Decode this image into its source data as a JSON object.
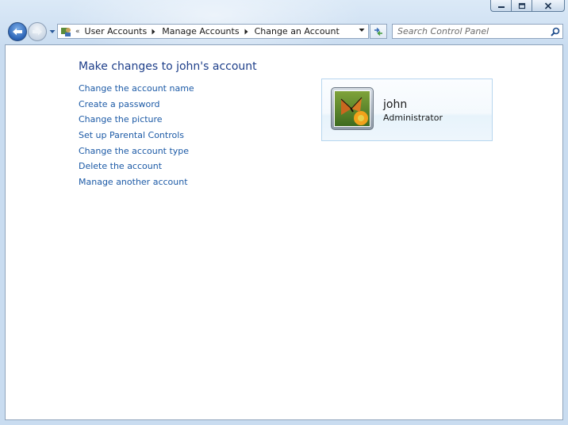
{
  "address_bar": {
    "crumbs": [
      "User Accounts",
      "Manage Accounts",
      "Change an Account"
    ]
  },
  "search": {
    "placeholder": "Search Control Panel"
  },
  "main": {
    "heading": "Make changes to john's account",
    "links": [
      "Change the account name",
      "Create a password",
      "Change the picture",
      "Set up Parental Controls",
      "Change the account type",
      "Delete the account"
    ],
    "manage_link": "Manage another account"
  },
  "account": {
    "name": "john",
    "type": "Administrator",
    "picture_icon": "butterfly-flower-picture"
  },
  "colors": {
    "link": "#1c5aa6",
    "heading": "#1e3f8a",
    "card_border": "#b7d6ef"
  }
}
